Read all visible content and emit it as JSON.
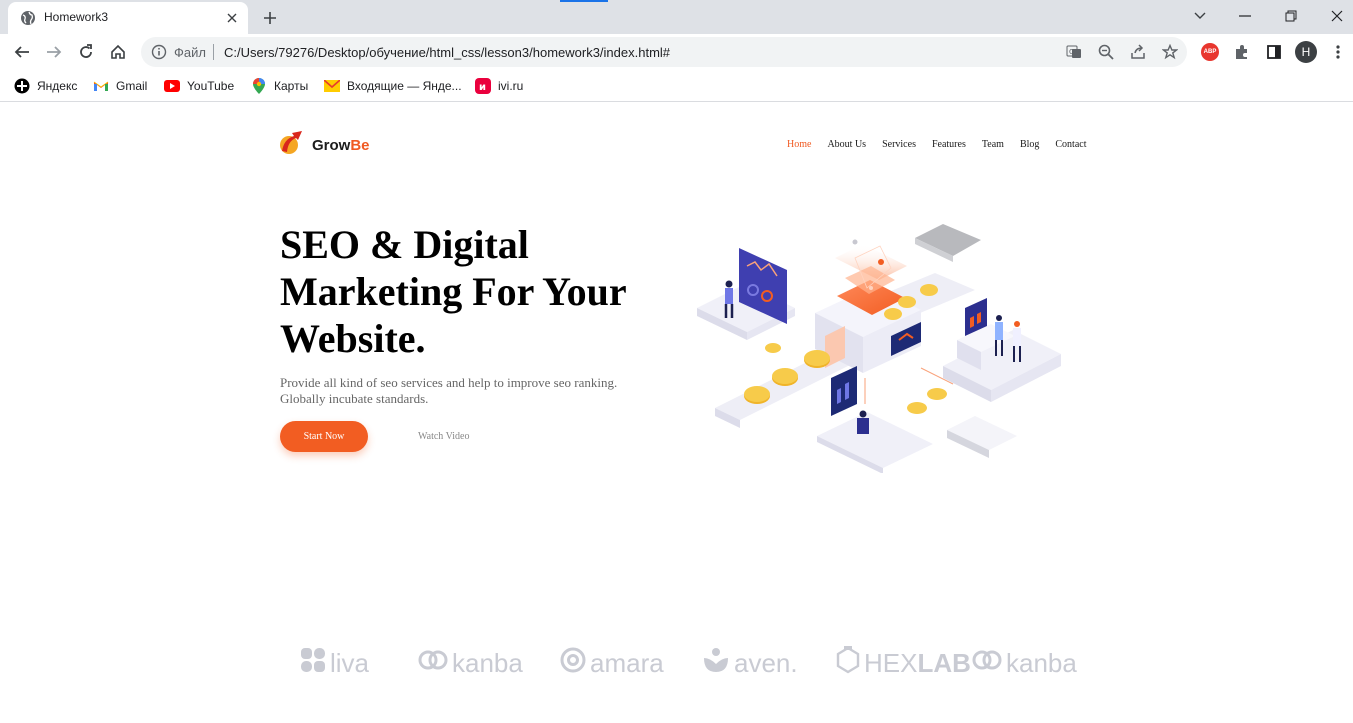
{
  "browser": {
    "tab_title": "Homework3",
    "url_scheme": "Файл",
    "url": "C:/Users/79276/Desktop/обучение/html_css/lesson3/homework3/index.html#",
    "profile_initial": "H",
    "abp_label": "ABP",
    "bookmarks": [
      {
        "label": "Яндекс",
        "icon": "yandex-icon"
      },
      {
        "label": "Gmail",
        "icon": "gmail-icon"
      },
      {
        "label": "YouTube",
        "icon": "youtube-icon"
      },
      {
        "label": "Карты",
        "icon": "maps-icon"
      },
      {
        "label": "Входящие — Янде...",
        "icon": "mail-icon"
      },
      {
        "label": "ivi.ru",
        "icon": "ivi-icon"
      }
    ]
  },
  "site": {
    "brand_grow": "Grow",
    "brand_be": "Be",
    "nav": [
      {
        "label": "Home",
        "active": true
      },
      {
        "label": "About Us"
      },
      {
        "label": "Services"
      },
      {
        "label": "Features"
      },
      {
        "label": "Team"
      },
      {
        "label": "Blog"
      },
      {
        "label": "Contact"
      }
    ],
    "hero": {
      "title": "SEO & Digital Marketing For Your Website.",
      "text": "Provide all kind of seo services and help to improve seo ranking. Globally incubate standards.",
      "start_button": "Start Now",
      "video_button": "Watch Video"
    },
    "partners": [
      {
        "label": "liva",
        "icon": "liva-logo-icon"
      },
      {
        "label": "kanba",
        "icon": "kanba-logo-icon"
      },
      {
        "label": "amara",
        "icon": "amara-logo-icon"
      },
      {
        "label": "aven.",
        "icon": "aven-logo-icon"
      },
      {
        "label": "HEX",
        "label2": "LAB",
        "icon": "hexlab-logo-icon"
      },
      {
        "label": "kanba",
        "icon": "kanba-logo-icon"
      }
    ],
    "colors": {
      "accent": "#f25d22",
      "partner_logo": "#c9cbd3"
    }
  }
}
